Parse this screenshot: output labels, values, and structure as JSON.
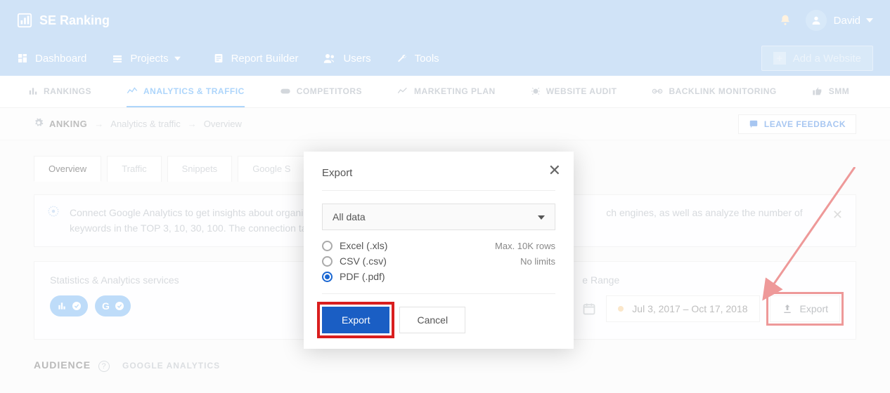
{
  "brand": "SE Ranking",
  "user": {
    "name": "David"
  },
  "mainnav": {
    "dashboard": "Dashboard",
    "projects": "Projects",
    "report_builder": "Report Builder",
    "users": "Users",
    "tools": "Tools",
    "add_website": "Add a Website"
  },
  "subtabs": {
    "rankings": "RANKINGS",
    "analytics": "ANALYTICS & TRAFFIC",
    "competitors": "COMPETITORS",
    "marketing": "MARKETING PLAN",
    "audit": "WEBSITE AUDIT",
    "backlink": "BACKLINK MONITORING",
    "smm": "SMM"
  },
  "breadcrumb": {
    "root": "ANKING",
    "mid": "Analytics & traffic",
    "leaf": "Overview"
  },
  "feedback_label": "LEAVE FEEDBACK",
  "inner_tabs": {
    "overview": "Overview",
    "traffic": "Traffic",
    "snippets": "Snippets",
    "gs": "Google S"
  },
  "banner_text": "Connect Google Analytics to get insights about organic                                                                                                             ch engines, as well as analyze the number of keywords in the TOP 3, 10, 30, 100. The connection tal",
  "services_title": "Statistics & Analytics services",
  "range_label": "e Range",
  "date_range": "Jul 3, 2017 – Oct 17, 2018",
  "export_label": "Export",
  "audience": {
    "title": "AUDIENCE",
    "sub": "GOOGLE ANALYTICS"
  },
  "modal": {
    "title": "Export",
    "select_value": "All data",
    "options": {
      "xls": {
        "label": "Excel (.xls)",
        "note": "Max. 10K rows",
        "checked": false
      },
      "csv": {
        "label": "CSV (.csv)",
        "note": "No limits",
        "checked": false
      },
      "pdf": {
        "label": "PDF (.pdf)",
        "note": "",
        "checked": true
      }
    },
    "export_btn": "Export",
    "cancel_btn": "Cancel"
  }
}
